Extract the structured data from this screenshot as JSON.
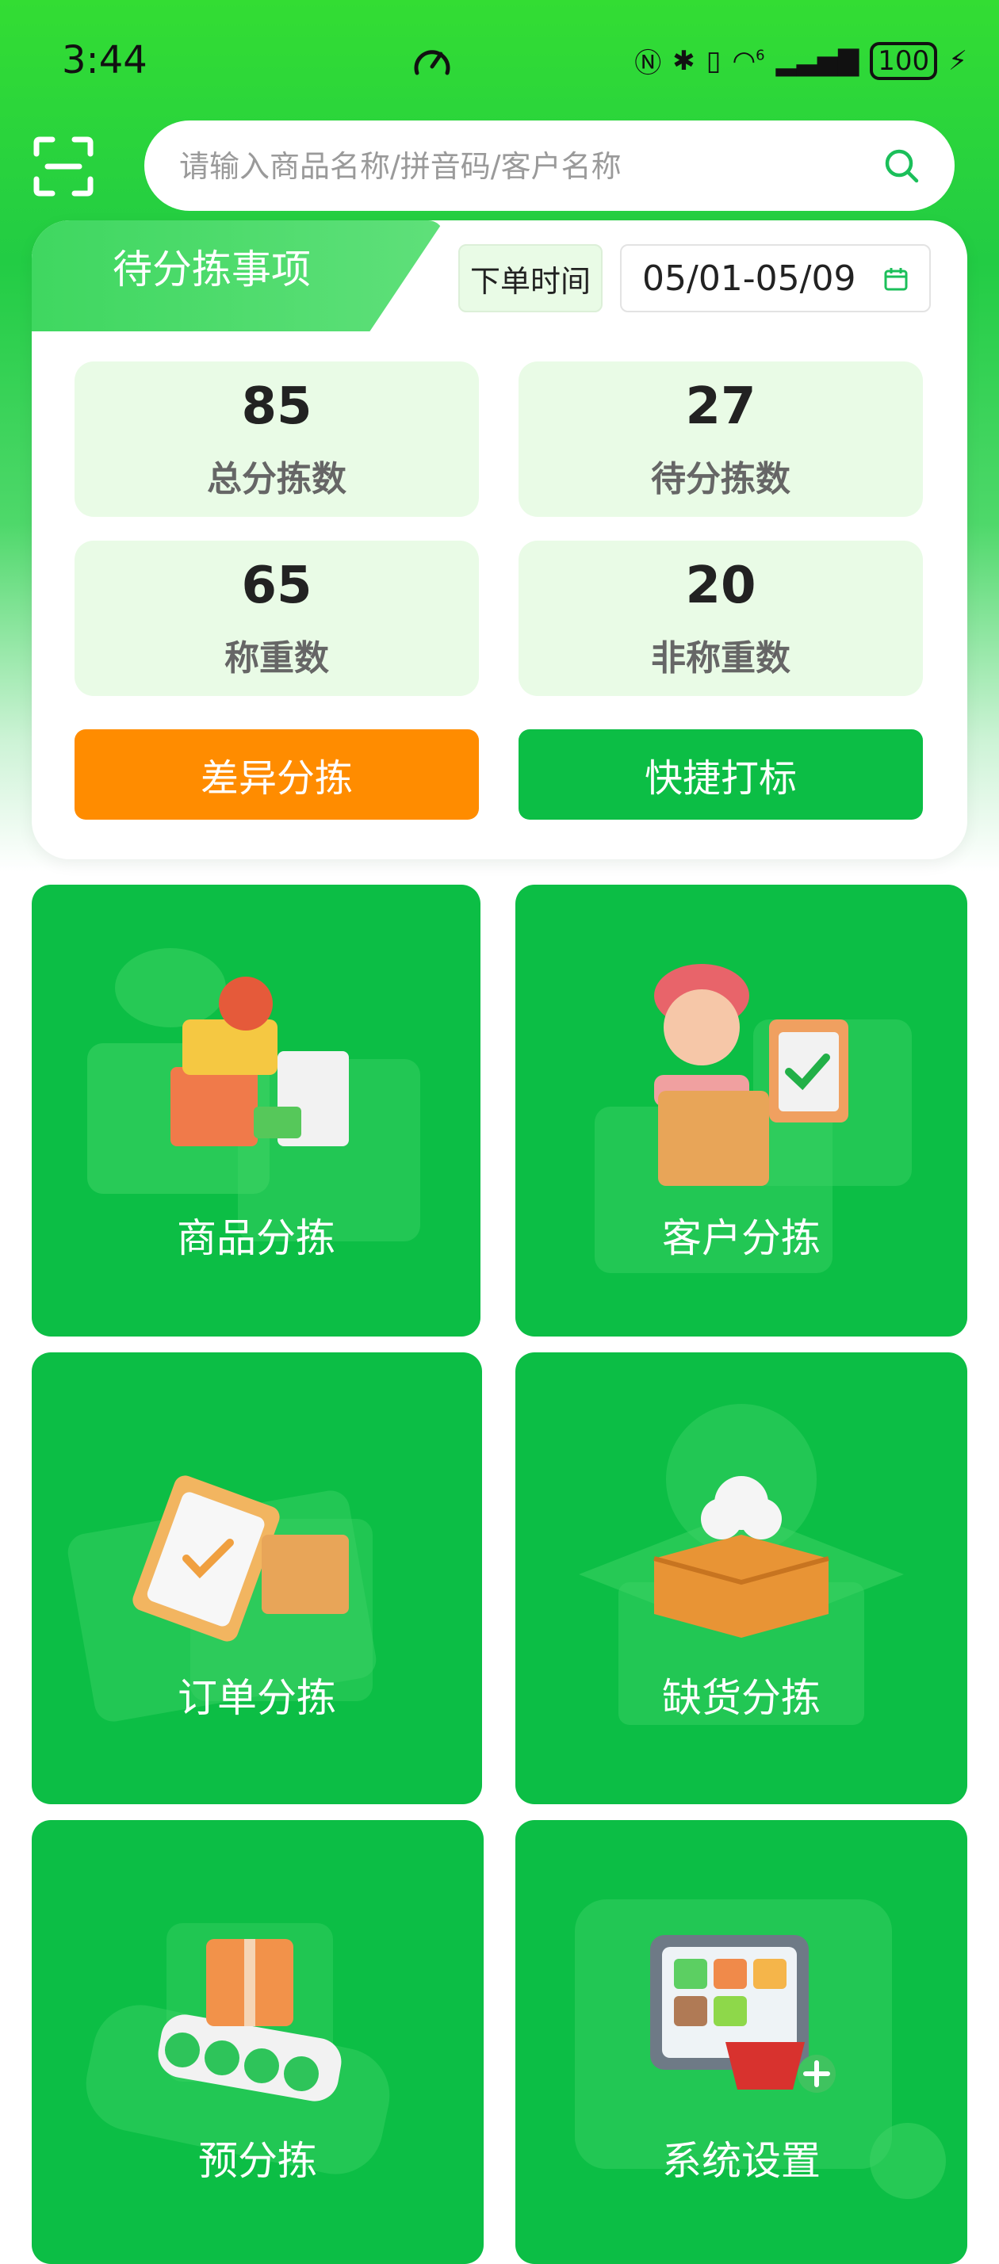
{
  "status_bar": {
    "time": "3:44",
    "battery": "100",
    "network_badge": "6"
  },
  "search": {
    "placeholder": "请输入商品名称/拼音码/客户名称"
  },
  "pending": {
    "title": "待分拣事项",
    "date_label": "下单时间",
    "date_range": "05/01-05/09",
    "stats": [
      {
        "value": "85",
        "label": "总分拣数"
      },
      {
        "value": "27",
        "label": "待分拣数"
      },
      {
        "value": "65",
        "label": "称重数"
      },
      {
        "value": "20",
        "label": "非称重数"
      }
    ],
    "buttons": {
      "diff": "差异分拣",
      "mark": "快捷打标"
    }
  },
  "tiles": [
    {
      "label": "商品分拣"
    },
    {
      "label": "客户分拣"
    },
    {
      "label": "订单分拣"
    },
    {
      "label": "缺货分拣"
    },
    {
      "label": "预分拣"
    },
    {
      "label": "系统设置"
    }
  ],
  "colors": {
    "primary_green": "#0cbe45",
    "accent_orange": "#ff8c00",
    "stat_bg": "#e9fbe6"
  }
}
